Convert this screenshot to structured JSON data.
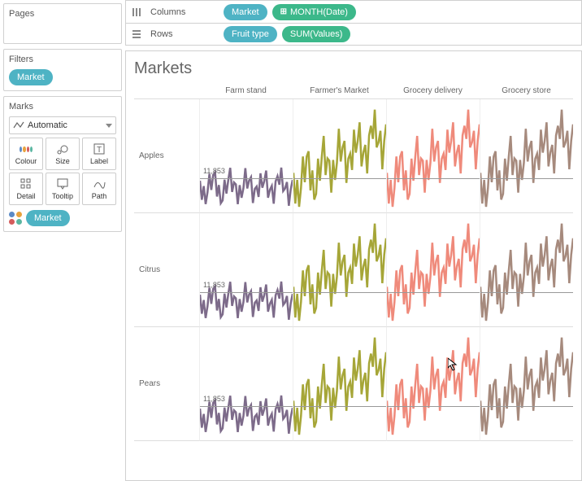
{
  "sidebar": {
    "pages": {
      "title": "Pages"
    },
    "filters": {
      "title": "Filters",
      "pill": "Market"
    },
    "marks": {
      "title": "Marks",
      "dropdown": "Automatic",
      "buttons": [
        "Colour",
        "Size",
        "Label",
        "Detail",
        "Tooltip",
        "Path"
      ],
      "colorPill": "Market"
    }
  },
  "shelves": {
    "columns": {
      "label": "Columns",
      "pills": [
        {
          "text": "Market",
          "color": "blue"
        },
        {
          "text": "MONTH(Date)",
          "color": "green",
          "plus": true
        }
      ]
    },
    "rows": {
      "label": "Rows",
      "pills": [
        {
          "text": "Fruit type",
          "color": "blue"
        },
        {
          "text": "SUM(Values)",
          "color": "green"
        }
      ]
    }
  },
  "viz": {
    "title": "Markets",
    "colHeaders": [
      "Farm stand",
      "Farmer's Market",
      "Grocery delivery",
      "Grocery store"
    ],
    "rowHeaders": [
      "Apples",
      "Citrus",
      "Pears"
    ],
    "refLabel": "11,853",
    "refLinePos": 0.7,
    "colors": {
      "Farm stand": "#7d6b8a",
      "Farmer's Market": "#a6a638",
      "Grocery delivery": "#ef8a7b",
      "Grocery store": "#a68a7d"
    }
  },
  "chart_data": {
    "type": "line",
    "title": "Markets",
    "xlabel": "MONTH(Date)",
    "ylabel": "SUM(Values)",
    "reference_line": 11853,
    "facets_col": [
      "Farm stand",
      "Farmer's Market",
      "Grocery delivery",
      "Grocery store"
    ],
    "facets_row": [
      "Apples",
      "Citrus",
      "Pears"
    ],
    "x": "monthly index (approx 60 points)",
    "ylim_approx": [
      0,
      30000
    ],
    "series": {
      "Apples": {
        "Farm stand": "noisy low series ~6k–12k, slight late rise",
        "Farmer's Market": "rising jagged ~8k→28k",
        "Grocery delivery": "rising jagged ~6k→20k",
        "Grocery store": "rising jagged ~8k→26k"
      },
      "Citrus": {
        "Farm stand": "noisy low ~5k–12k, late uptick",
        "Farmer's Market": "rising ~8k→30k",
        "Grocery delivery": "rising ~6k→24k",
        "Grocery store": "very jagged rising ~6k→28k"
      },
      "Pears": {
        "Farm stand": "noisy low ~5k–11k flat",
        "Farmer's Market": "rising ~8k→26k",
        "Grocery delivery": "rising ~6k→20k",
        "Grocery store": "rising jagged ~8k→26k"
      }
    }
  }
}
